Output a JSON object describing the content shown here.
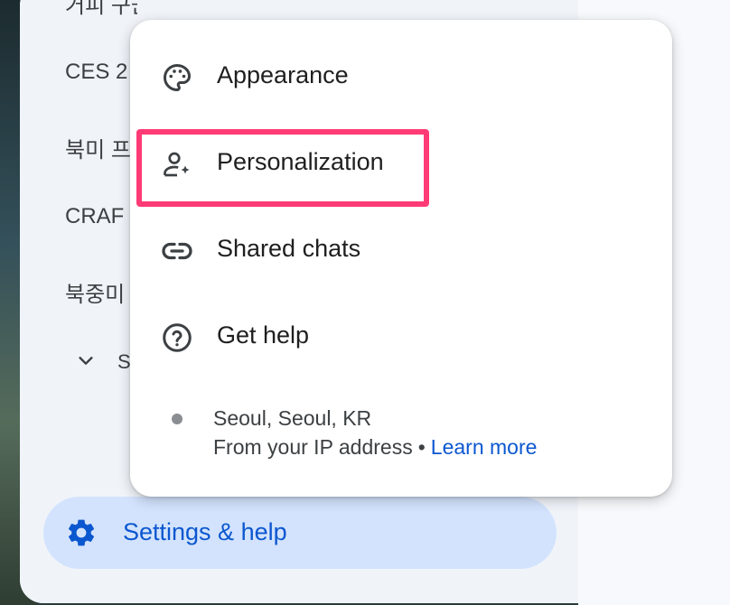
{
  "sidebar": {
    "recent_items": [
      "거피 구군 군극",
      "CES 2",
      "북미 프",
      "CRAF",
      "북중미"
    ],
    "expand_label": "S"
  },
  "settings_button": {
    "label": "Settings & help",
    "icon": "gear-icon"
  },
  "menu": {
    "items": [
      {
        "label": "Appearance",
        "icon": "palette-icon"
      },
      {
        "label": "Personalization",
        "icon": "person-sparkle-icon"
      },
      {
        "label": "Shared chats",
        "icon": "link-icon"
      },
      {
        "label": "Get help",
        "icon": "help-circle-icon"
      }
    ],
    "location": {
      "place": "Seoul, Seoul, KR",
      "source": "From your IP address",
      "separator": "•",
      "link": "Learn more"
    }
  },
  "colors": {
    "accent": "#0b57d0",
    "settings_bg": "#d3e3fd",
    "highlight": "#ff3b76"
  }
}
